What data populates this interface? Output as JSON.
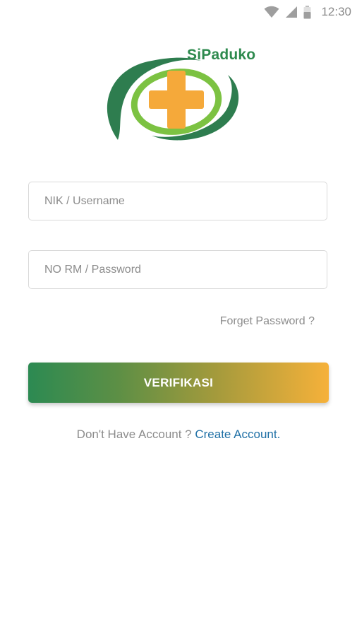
{
  "status_bar": {
    "time": "12:30",
    "icons": [
      "wifi-icon",
      "cell-signal-icon",
      "battery-icon"
    ]
  },
  "logo": {
    "text": "SiPaduko",
    "colors": {
      "green_dark": "#2e7d4f",
      "green_light": "#7cc242",
      "cross": "#f5a93a"
    }
  },
  "form": {
    "username_placeholder": "NIK / Username",
    "username_value": "",
    "password_placeholder": "NO RM / Password",
    "password_value": "",
    "forget_password": "Forget Password ?",
    "verify_label": "VERIFIKASI"
  },
  "signup": {
    "prompt": "Don't Have Account ? ",
    "link": "Create Account."
  },
  "colors": {
    "button_gradient_start": "#2c8a52",
    "button_gradient_end": "#f6b13a",
    "link": "#1e6fa5",
    "muted_text": "#8c8c8c"
  }
}
